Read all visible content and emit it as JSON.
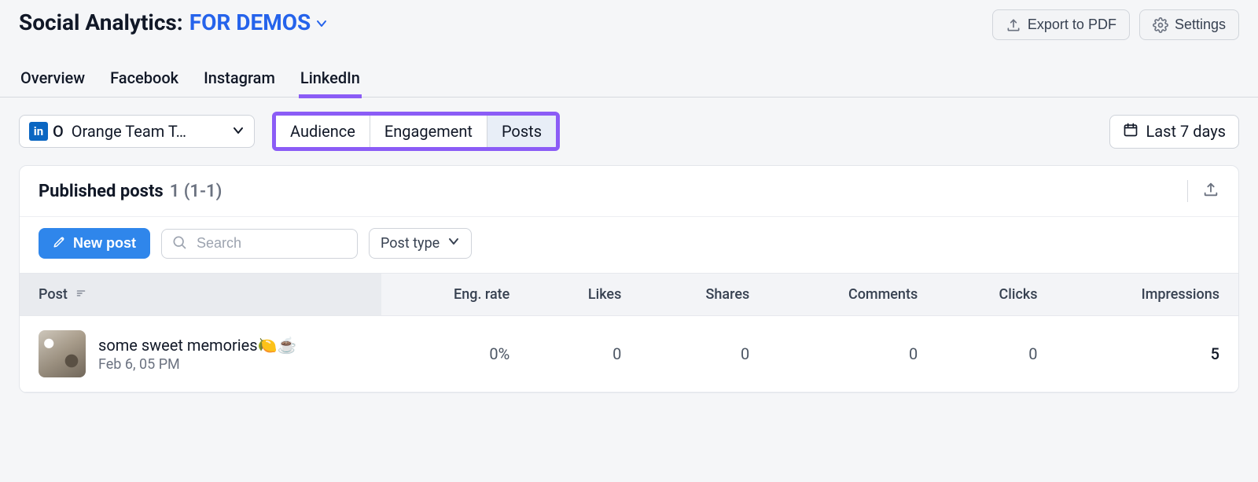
{
  "header": {
    "title_prefix": "Social Analytics:",
    "project_name": "FOR DEMOS",
    "export_label": "Export to PDF",
    "settings_label": "Settings"
  },
  "tabs": {
    "items": [
      "Overview",
      "Facebook",
      "Instagram",
      "LinkedIn"
    ],
    "active": "LinkedIn"
  },
  "subbar": {
    "account_initial": "O",
    "account_label": "Orange Team T…",
    "segments": [
      "Audience",
      "Engagement",
      "Posts"
    ],
    "active_segment": "Posts",
    "date_range": "Last 7 days"
  },
  "panel": {
    "title": "Published posts",
    "count_text": "1 (1-1)",
    "new_post_label": "New post",
    "search_placeholder": "Search",
    "filter_label": "Post type"
  },
  "table": {
    "columns": [
      "Post",
      "Eng. rate",
      "Likes",
      "Shares",
      "Comments",
      "Clicks",
      "Impressions"
    ],
    "rows": [
      {
        "title": "some sweet memories🍋☕",
        "date": "Feb 6, 05 PM",
        "eng_rate": "0%",
        "likes": "0",
        "shares": "0",
        "comments": "0",
        "clicks": "0",
        "impressions": "5"
      }
    ]
  }
}
